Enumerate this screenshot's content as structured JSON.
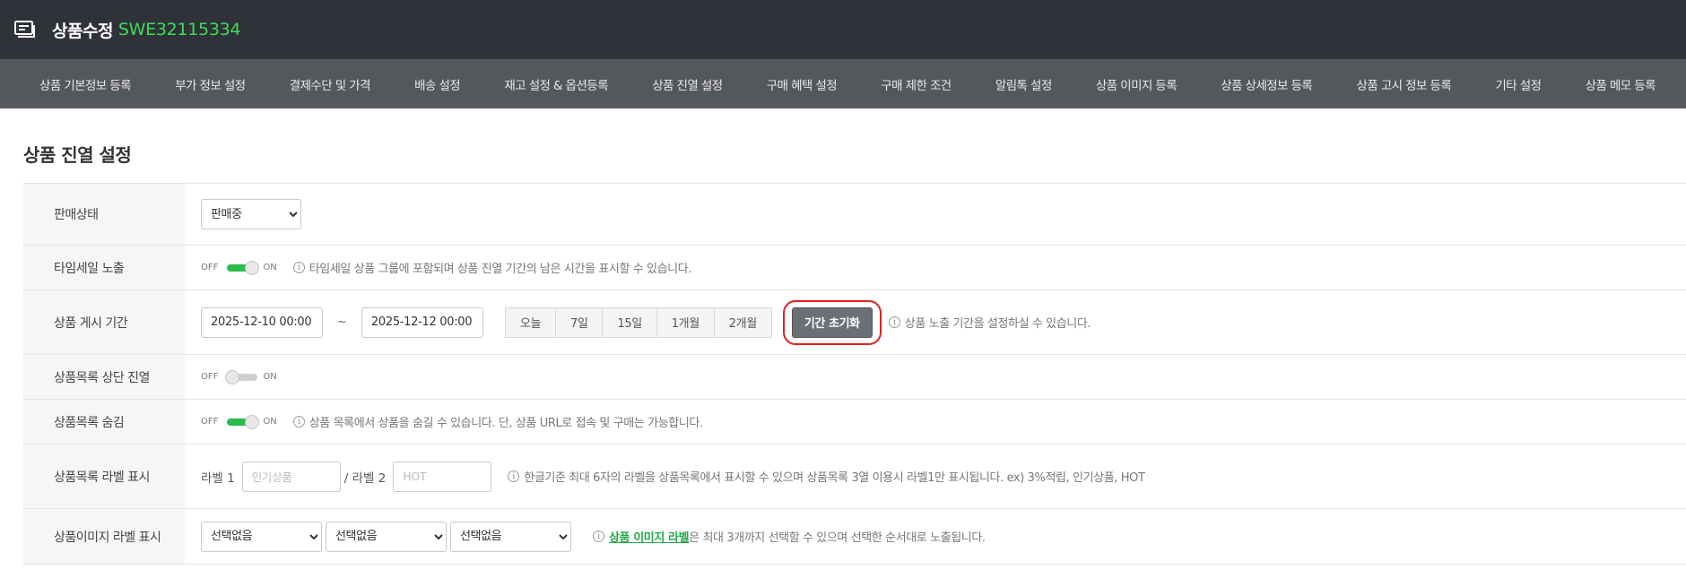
{
  "header": {
    "icon": "product-edit-icon",
    "title": "상품수정",
    "code": "SWE32115334",
    "code_color": "#3ddc5a"
  },
  "nav": [
    "상품 기본정보 등록",
    "부가 정보 설정",
    "결제수단 및 가격",
    "배송 설정",
    "재고 설정 & 옵션등록",
    "상품 진열 설정",
    "구매 혜택 설정",
    "구매 제한 조건",
    "알림톡 설정",
    "상품 이미지 등록",
    "상품 상세정보 등록",
    "상품 고시 정보 등록",
    "기타 설정",
    "상품 메모 등록"
  ],
  "section": {
    "title": "상품 진열 설정"
  },
  "rows": {
    "sale_status": {
      "label": "판매상태",
      "value": "판매중"
    },
    "timesale": {
      "label": "타임세일 노출",
      "off": "OFF",
      "on": "ON",
      "state": "on",
      "help": "타임세일 상품 그룹에 포함되며 상품 진열 기간의 남은 시간을 표시할 수 있습니다."
    },
    "period": {
      "label": "상품 게시 기간",
      "start": "2025-12-10 00:00",
      "tilde": "~",
      "end": "2025-12-12 00:00",
      "buttons": [
        "오늘",
        "7일",
        "15일",
        "1개월",
        "2개월"
      ],
      "reset": "기간 초기화",
      "help": "상품 노출 기간을 설정하실 수 있습니다."
    },
    "top_display": {
      "label": "상품목록 상단 진열",
      "off": "OFF",
      "on": "ON",
      "state": "off"
    },
    "hide": {
      "label": "상품목록 숨김",
      "off": "OFF",
      "on": "ON",
      "state": "on",
      "help": "상품 목록에서 상품을 숨길 수 있습니다. 단, 상품 URL로 접속 및 구매는 가능합니다."
    },
    "list_label": {
      "label": "상품목록 라벨 표시",
      "label1": "라벨 1",
      "placeholder1": "인기상품",
      "sep": "/ 라벨 2",
      "placeholder2": "HOT",
      "help": "한글기준 최대 6자의 라벨을 상품목록에서 표시할 수 있으며 상품목록 3열 이용시 라벨1만 표시됩니다. ex) 3%적립, 인기상품, HOT"
    },
    "image_label": {
      "label": "상품이미지 라벨 표시",
      "selects": [
        "선택없음",
        "선택없음",
        "선택없음"
      ],
      "help_link": "상품 이미지 라벨",
      "help_rest": "은 최대 3개까지 선택할 수 있으며 선택한 순서대로 노출됩니다."
    }
  },
  "info_glyph": "i",
  "colors": {
    "topbar": "#2f3238",
    "nav": "#54575c",
    "toggle_on": "#2bbb4a",
    "highlight": "#e02020"
  }
}
